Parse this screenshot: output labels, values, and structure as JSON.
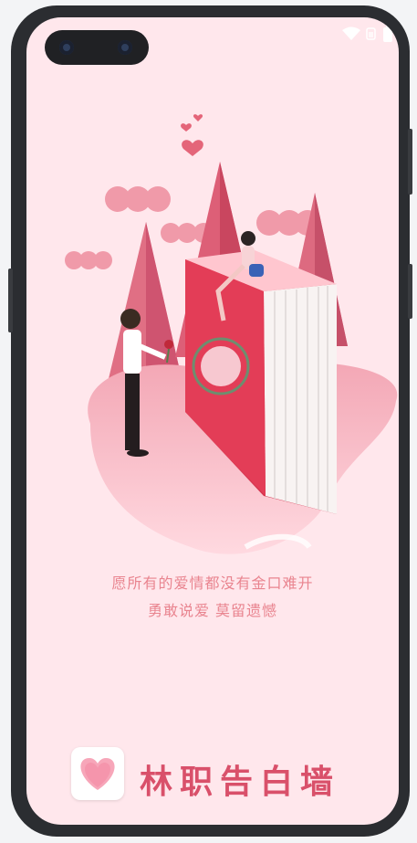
{
  "splash": {
    "tagline_line1": "愿所有的爱情都没有金口难开",
    "tagline_line2": "勇敢说爱 莫留遗憾",
    "app_name": "林职告白墙"
  },
  "status_bar": {
    "icons": [
      "wifi-icon",
      "signal-icon",
      "battery-icon"
    ]
  },
  "colors": {
    "background": "#ffe7ec",
    "accent": "#d9506a",
    "tagline": "#e9848f",
    "book_red": "#e23d55"
  }
}
